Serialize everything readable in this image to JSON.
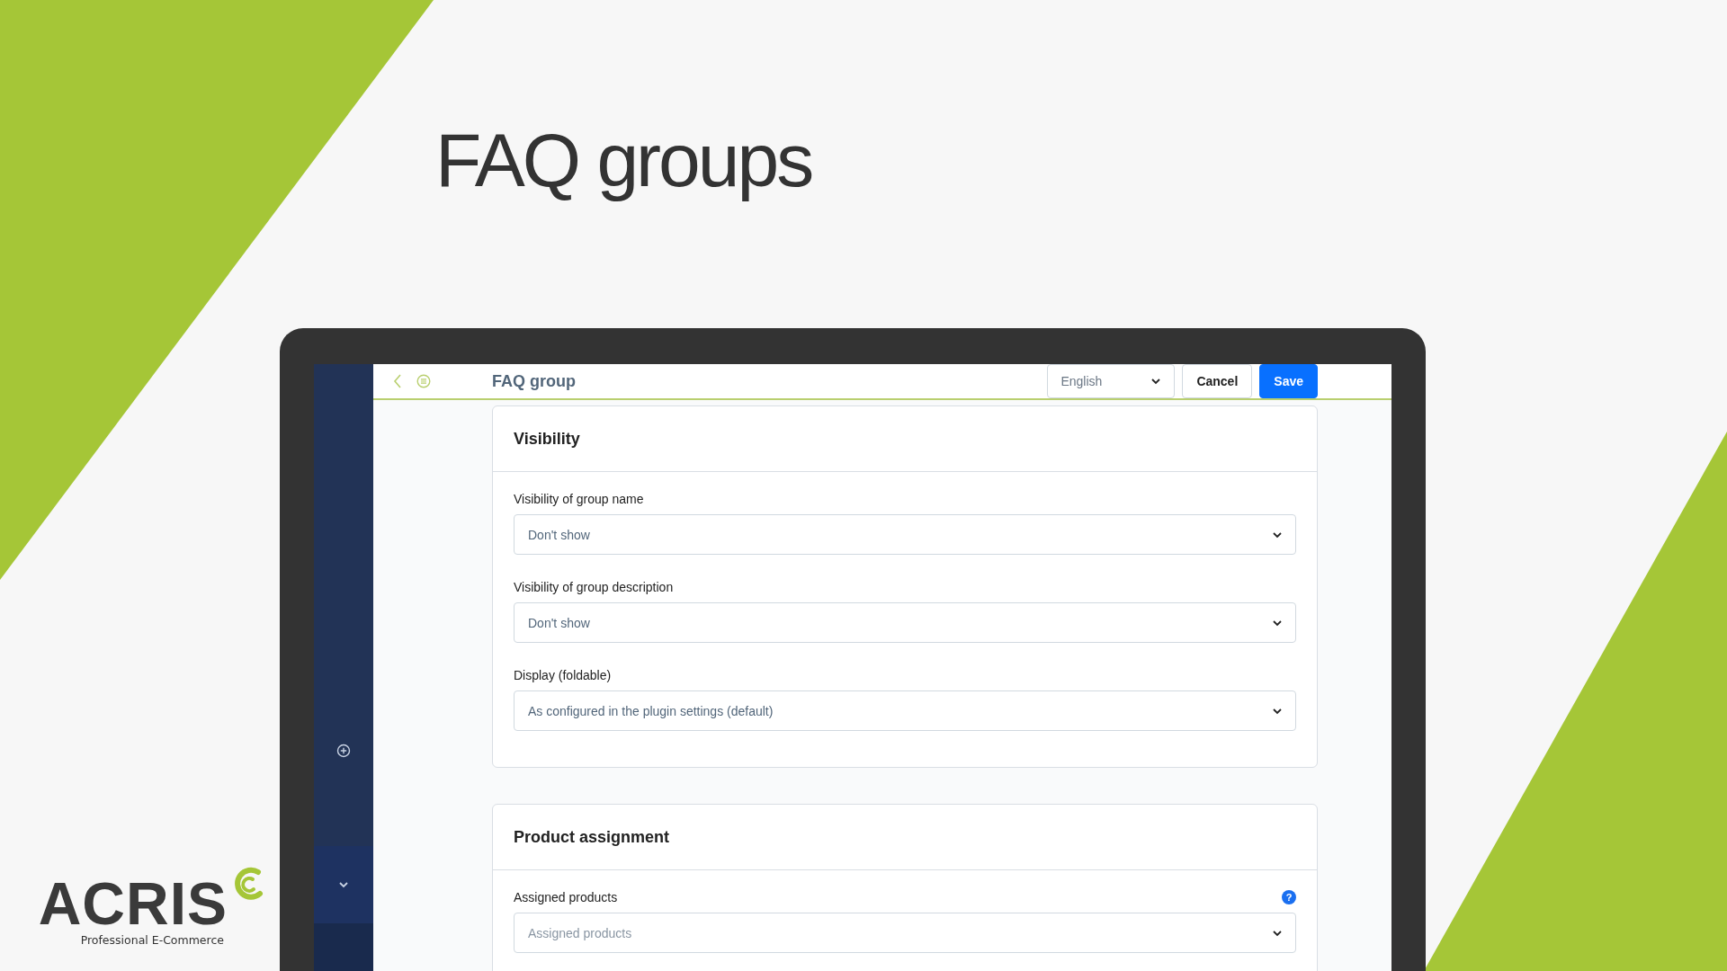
{
  "headline": "FAQ groups",
  "logo": {
    "name": "ACRIS",
    "tagline": "Professional E-Commerce"
  },
  "app": {
    "header": {
      "title": "FAQ group",
      "language": "English",
      "buttons": [
        {
          "label": "Cancel",
          "kind": "secondary"
        },
        {
          "label": "Save",
          "kind": "primary"
        }
      ]
    },
    "cards": [
      {
        "title": "Visibility",
        "fields": [
          {
            "label": "Visibility of group name",
            "value": "Don't show"
          },
          {
            "label": "Visibility of group description",
            "value": "Don't show"
          },
          {
            "label": "Display (foldable)",
            "value": "As configured in the plugin settings (default)"
          }
        ]
      },
      {
        "title": "Product assignment",
        "fields": [
          {
            "label": "Assigned products",
            "placeholder": "Assigned products",
            "help": "?"
          }
        ]
      }
    ]
  }
}
